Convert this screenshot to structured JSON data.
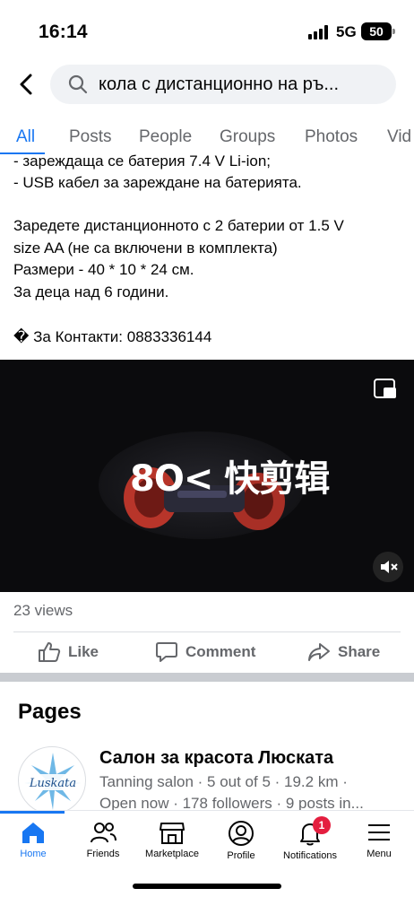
{
  "status_bar": {
    "time": "16:14",
    "network": "5G",
    "battery": "50"
  },
  "search": {
    "query": "кола с дистанционно на ръ..."
  },
  "tabs": [
    {
      "label": "All",
      "active": true
    },
    {
      "label": "Posts"
    },
    {
      "label": "People"
    },
    {
      "label": "Groups"
    },
    {
      "label": "Photos"
    },
    {
      "label": "Vid"
    }
  ],
  "post": {
    "lines": [
      "- зареждаща се батерия 7.4 V Li-ion;",
      "- USB кабел за зареждане на батерията.",
      "",
      " Заредете дистанционното с 2 батерии от 1.5 V",
      "size AA (не са включени в комплекта)",
      "Размери -  40 * 10 * 24 см.",
      "За деца над 6 години.",
      "",
      "� За Контакти: 0883336144"
    ],
    "video_overlay_text": "8O< 快剪辑",
    "views": "23 views",
    "actions": {
      "like": "Like",
      "comment": "Comment",
      "share": "Share"
    }
  },
  "pages_section": {
    "title": "Pages",
    "item": {
      "name": "Салон за красота Люската",
      "meta_line1": "Tanning salon · 5 out of 5 · 19.2 km ·",
      "meta_line2": "Open now · 178 followers · 9 posts in...",
      "logo_text": "Luskata"
    }
  },
  "bottom_nav": [
    {
      "label": "Home",
      "icon": "home-icon",
      "active": true
    },
    {
      "label": "Friends",
      "icon": "friends-icon"
    },
    {
      "label": "Marketplace",
      "icon": "marketplace-icon"
    },
    {
      "label": "Profile",
      "icon": "profile-icon"
    },
    {
      "label": "Notifications",
      "icon": "bell-icon",
      "badge": "1"
    },
    {
      "label": "Menu",
      "icon": "menu-icon"
    }
  ],
  "colors": {
    "accent": "#1877f2",
    "badge": "#e41e3f",
    "secondary_text": "#65676b"
  }
}
